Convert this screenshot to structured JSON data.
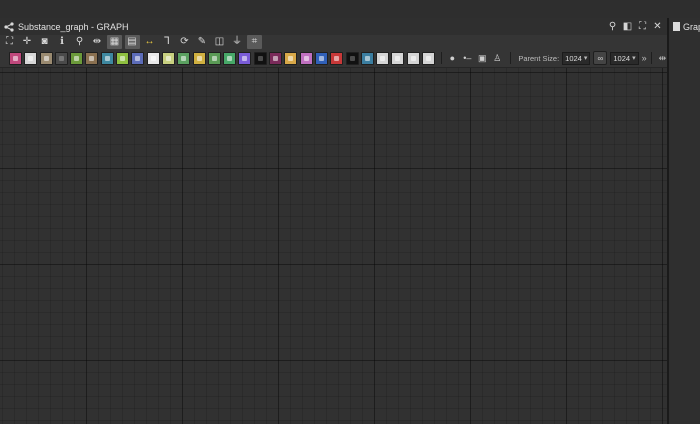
{
  "panel": {
    "title": "Substance_graph - GRAPH",
    "actions": [
      {
        "name": "pin-icon",
        "glyph": "⚲"
      },
      {
        "name": "restore-icon",
        "glyph": "◧"
      },
      {
        "name": "maximize-icon",
        "glyph": "⛶"
      },
      {
        "name": "close-icon",
        "glyph": "✕"
      }
    ]
  },
  "toolbar1": [
    {
      "name": "frame-all-icon",
      "glyph": "⛶"
    },
    {
      "name": "frame-selected-icon",
      "glyph": "✛"
    },
    {
      "name": "camera-icon",
      "glyph": "◙"
    },
    {
      "name": "info-icon",
      "glyph": "ℹ"
    },
    {
      "name": "search-icon",
      "glyph": "⚲"
    },
    {
      "name": "node-link-icon",
      "glyph": "⇹"
    },
    {
      "name": "graph-layout-icon",
      "glyph": "▦",
      "active": true
    },
    {
      "name": "compute-icon",
      "glyph": "▤",
      "active": true
    },
    {
      "name": "connection-icon",
      "glyph": "↔",
      "color": "#e8c840"
    },
    {
      "name": "align-icon",
      "glyph": "⅂"
    },
    {
      "name": "refresh-icon",
      "glyph": "⟳"
    },
    {
      "name": "tools-icon",
      "glyph": "✎"
    },
    {
      "name": "export-icon",
      "glyph": "◫"
    },
    {
      "name": "debug-icon",
      "glyph": "⏚"
    },
    {
      "name": "grid-snap-icon",
      "glyph": "⌗",
      "active": true
    }
  ],
  "toolbar2": {
    "nodes": [
      {
        "name": "bitmap-node-icon",
        "bg": "#c0487c"
      },
      {
        "name": "svg-node-icon",
        "bg": "#d7d7d7"
      },
      {
        "name": "color-node-icon",
        "bg": "#9a8a70"
      },
      {
        "name": "random-node-icon",
        "bg": "#4a4a4a",
        "dark": true
      },
      {
        "name": "gradient-node-icon",
        "bg": "#6b9a3a"
      },
      {
        "name": "curve-node-icon",
        "bg": "#8a7050"
      },
      {
        "name": "tile-node-icon",
        "bg": "#3e88a0"
      },
      {
        "name": "warp-node-icon",
        "bg": "#8fc040"
      },
      {
        "name": "blur-node-icon",
        "bg": "#5c6cb8"
      },
      {
        "name": "grid-node-icon",
        "bg": "#e8e8e8"
      },
      {
        "name": "shape-node-icon",
        "bg": "#c8d080"
      },
      {
        "name": "add-pattern-node-icon",
        "bg": "#5aa060"
      },
      {
        "name": "rainbow-node-icon",
        "bg": "#d0b040"
      },
      {
        "name": "sphere-node-icon",
        "bg": "#5a9a55"
      },
      {
        "name": "green-node-icon",
        "bg": "#47a868"
      },
      {
        "name": "hue-node-icon",
        "bg": "#7a5cd8"
      },
      {
        "name": "fxmap-node-icon",
        "bg": "#111111",
        "dark": true
      },
      {
        "name": "histogram-node-icon",
        "bg": "#7a2a5a"
      },
      {
        "name": "warning-node-icon",
        "bg": "#d8a848"
      },
      {
        "name": "text-node-icon",
        "bg": "#c070c0"
      },
      {
        "name": "transform-node-icon",
        "bg": "#3060b8"
      },
      {
        "name": "red-node-icon",
        "bg": "#c83838"
      },
      {
        "name": "value-node-icon",
        "bg": "#111111",
        "dark": true
      },
      {
        "name": "frame-node-icon",
        "bg": "#3b7ea0"
      },
      {
        "name": "output-node-icon",
        "bg": "#d5d5d5"
      },
      {
        "name": "input-node-icon",
        "bg": "#d5d5d5"
      },
      {
        "name": "pixel-processor-icon",
        "bg": "#d5d5d5"
      },
      {
        "name": "comment-node-icon",
        "bg": "#d5d5d5"
      }
    ],
    "extras": [
      {
        "name": "comment-bubble-icon",
        "glyph": "●"
      },
      {
        "name": "pin-node-icon",
        "glyph": "•–"
      },
      {
        "name": "frame-box-icon",
        "glyph": "▣"
      },
      {
        "name": "navigation-pin-icon",
        "glyph": "♙"
      }
    ],
    "parent_size_label": "Parent Size:",
    "size_value_1": "1024",
    "size_value_2": "1024",
    "more_glyph": "»",
    "extra_glyph": "⇹"
  },
  "right_panel": {
    "title": "Grap"
  }
}
